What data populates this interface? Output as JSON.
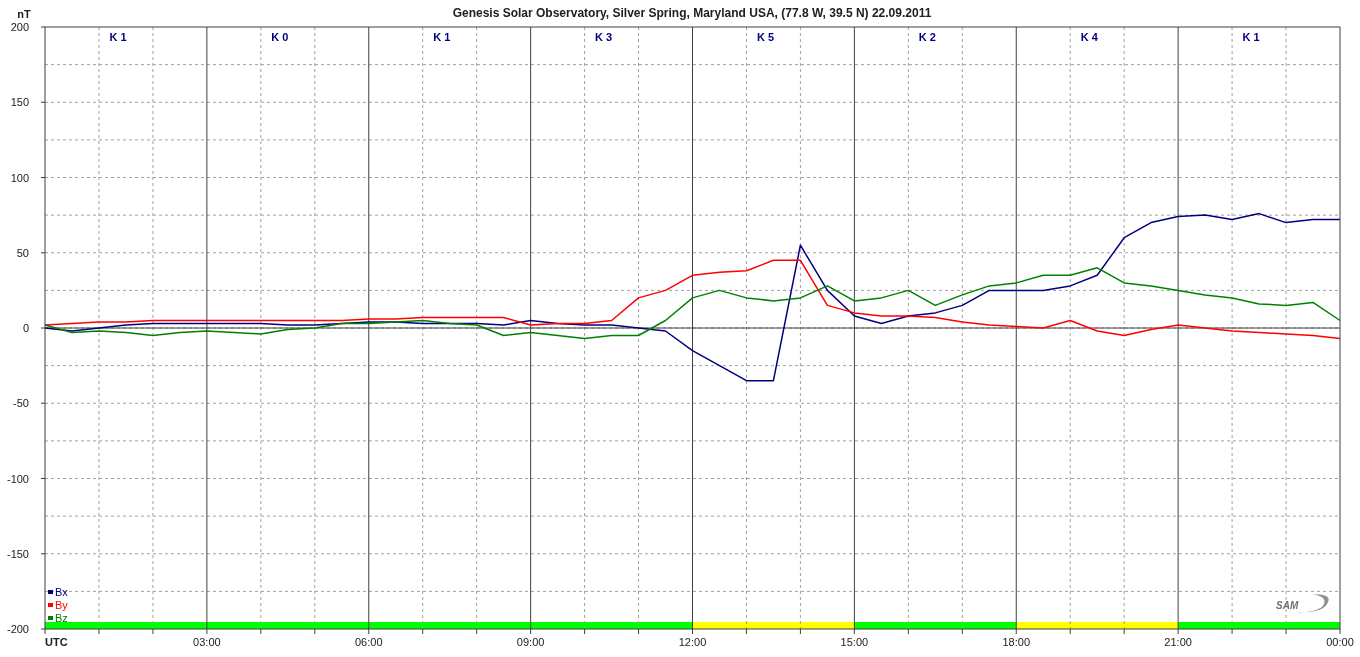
{
  "chart_data": {
    "type": "line",
    "title": "Genesis Solar Observatory, Silver Spring, Maryland USA, (77.8 W, 39.5 N)  22.09.2011",
    "xlabel": "UTC",
    "ylabel": "nT",
    "x": [
      0,
      0.5,
      1,
      1.5,
      2,
      2.5,
      3,
      3.5,
      4,
      4.5,
      5,
      5.5,
      6,
      6.5,
      7,
      7.5,
      8,
      8.5,
      9,
      9.5,
      10,
      10.5,
      11,
      11.5,
      12,
      12.5,
      13,
      13.5,
      14,
      14.5,
      15,
      15.5,
      16,
      16.5,
      17,
      17.5,
      18,
      18.5,
      19,
      19.5,
      20,
      20.5,
      21,
      21.5,
      22,
      22.5,
      23,
      23.5,
      24
    ],
    "series": [
      {
        "name": "Bx",
        "color": "#000080",
        "values": [
          0,
          -2,
          0,
          2,
          3,
          3,
          3,
          3,
          3,
          2,
          2,
          3,
          4,
          4,
          3,
          3,
          3,
          2,
          5,
          3,
          2,
          2,
          0,
          -2,
          -15,
          -25,
          -35,
          -35,
          55,
          25,
          8,
          3,
          8,
          10,
          15,
          25,
          25,
          25,
          28,
          35,
          60,
          70,
          74,
          75,
          72,
          76,
          70,
          72,
          72
        ]
      },
      {
        "name": "By",
        "color": "#ff0000",
        "values": [
          2,
          3,
          4,
          4,
          5,
          5,
          5,
          5,
          5,
          5,
          5,
          5,
          6,
          6,
          7,
          7,
          7,
          7,
          2,
          3,
          3,
          5,
          20,
          25,
          35,
          37,
          38,
          45,
          45,
          15,
          10,
          8,
          8,
          7,
          4,
          2,
          1,
          0,
          5,
          -2,
          -5,
          -1,
          2,
          0,
          -2,
          -3,
          -4,
          -5,
          -7
        ]
      },
      {
        "name": "Bz",
        "color": "#008000",
        "values": [
          2,
          -3,
          -2,
          -3,
          -5,
          -3,
          -2,
          -3,
          -4,
          -1,
          0,
          3,
          3,
          4,
          5,
          3,
          2,
          -5,
          -3,
          -5,
          -7,
          -5,
          -5,
          5,
          20,
          25,
          20,
          18,
          20,
          28,
          18,
          20,
          25,
          15,
          22,
          28,
          30,
          35,
          35,
          40,
          30,
          28,
          25,
          22,
          20,
          16,
          15,
          17,
          5
        ]
      }
    ],
    "xlim": [
      0,
      24
    ],
    "ylim": [
      -200,
      200
    ],
    "xticks": [
      {
        "value": 3,
        "label": "03:00"
      },
      {
        "value": 6,
        "label": "06:00"
      },
      {
        "value": 9,
        "label": "09:00"
      },
      {
        "value": 12,
        "label": "12:00"
      },
      {
        "value": 15,
        "label": "15:00"
      },
      {
        "value": 18,
        "label": "18:00"
      },
      {
        "value": 21,
        "label": "21:00"
      },
      {
        "value": 24,
        "label": "00:00"
      }
    ],
    "yticks": [
      -200,
      -150,
      -100,
      -50,
      0,
      50,
      100,
      150,
      200
    ],
    "grid": true,
    "legend": true
  },
  "k_index_periods": [
    {
      "label": "K 1",
      "color": "#00ff00"
    },
    {
      "label": "K 0",
      "color": "#00ff00"
    },
    {
      "label": "K 1",
      "color": "#00ff00"
    },
    {
      "label": "K 3",
      "color": "#00ff00"
    },
    {
      "label": "K 5",
      "color": "#ffff00"
    },
    {
      "label": "K 2",
      "color": "#00ff00"
    },
    {
      "label": "K 4",
      "color": "#ffff00"
    },
    {
      "label": "K 1",
      "color": "#00ff00"
    }
  ],
  "logo": {
    "text": "SAM"
  }
}
